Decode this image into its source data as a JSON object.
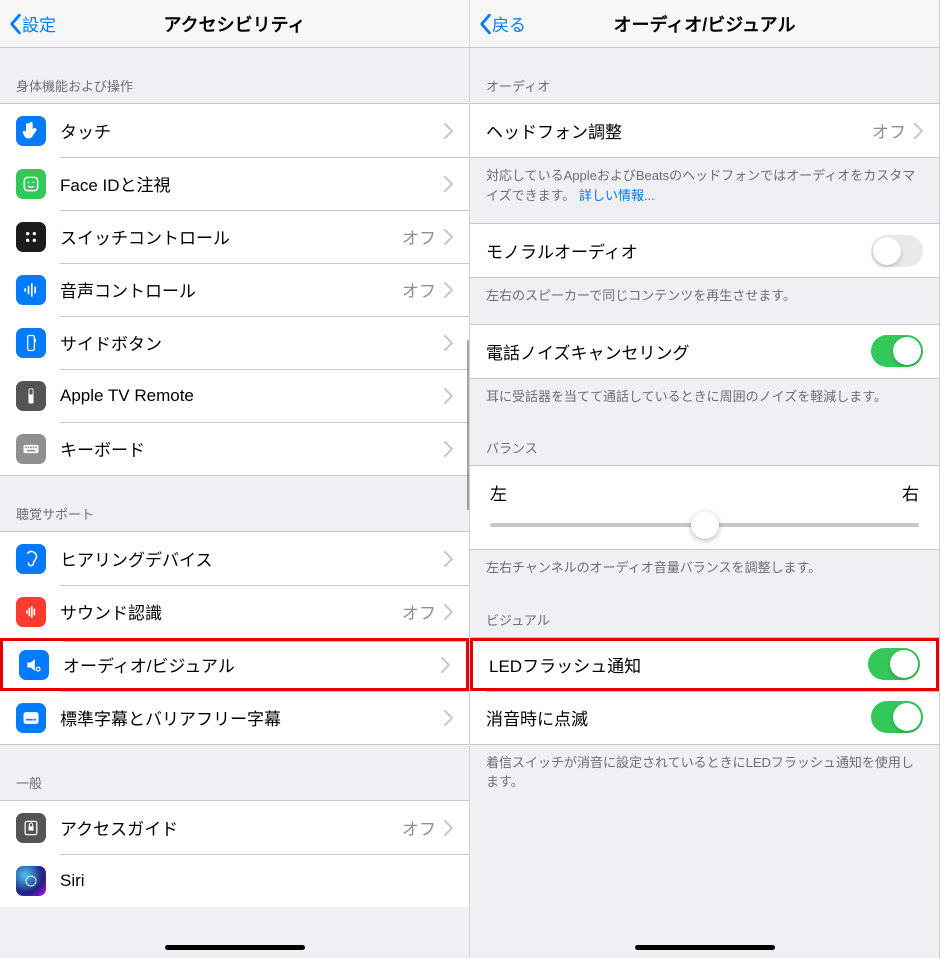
{
  "left": {
    "back": "設定",
    "title": "アクセシビリティ",
    "sections": {
      "physical_header": "身体機能および操作",
      "hearing_header": "聴覚サポート",
      "general_header": "一般"
    },
    "rows": {
      "touch": "タッチ",
      "face_id": "Face IDと注視",
      "switch_control": {
        "label": "スイッチコントロール",
        "value": "オフ"
      },
      "voice_control": {
        "label": "音声コントロール",
        "value": "オフ"
      },
      "side_button": "サイドボタン",
      "apple_tv": "Apple TV Remote",
      "keyboard": "キーボード",
      "hearing_devices": "ヒアリングデバイス",
      "sound_recognition": {
        "label": "サウンド認識",
        "value": "オフ"
      },
      "audio_visual": "オーディオ/ビジュアル",
      "subtitles": "標準字幕とバリアフリー字幕",
      "guided_access": {
        "label": "アクセスガイド",
        "value": "オフ"
      },
      "siri": "Siri"
    }
  },
  "right": {
    "back": "戻る",
    "title": "オーディオ/ビジュアル",
    "sections": {
      "audio_header": "オーディオ",
      "balance_header": "バランス",
      "visual_header": "ビジュアル"
    },
    "rows": {
      "headphone": {
        "label": "ヘッドフォン調整",
        "value": "オフ"
      },
      "mono_audio": "モノラルオーディオ",
      "noise_cancel": "電話ノイズキャンセリング",
      "led_flash": "LEDフラッシュ通知",
      "flash_silent": "消音時に点滅"
    },
    "footers": {
      "headphone": "対応しているAppleおよびBeatsのヘッドフォンではオーディオをカスタマイズできます。",
      "headphone_link": "詳しい情報...",
      "mono": "左右のスピーカーで同じコンテンツを再生させます。",
      "noise": "耳に受話器を当てて通話しているときに周囲のノイズを軽減します。",
      "balance": "左右チャンネルのオーディオ音量バランスを調整します。",
      "led": "着信スイッチが消音に設定されているときにLEDフラッシュ通知を使用します。"
    },
    "balance": {
      "left": "左",
      "right": "右"
    },
    "toggles": {
      "mono_audio": false,
      "noise_cancel": true,
      "led_flash": true,
      "flash_silent": true
    }
  }
}
